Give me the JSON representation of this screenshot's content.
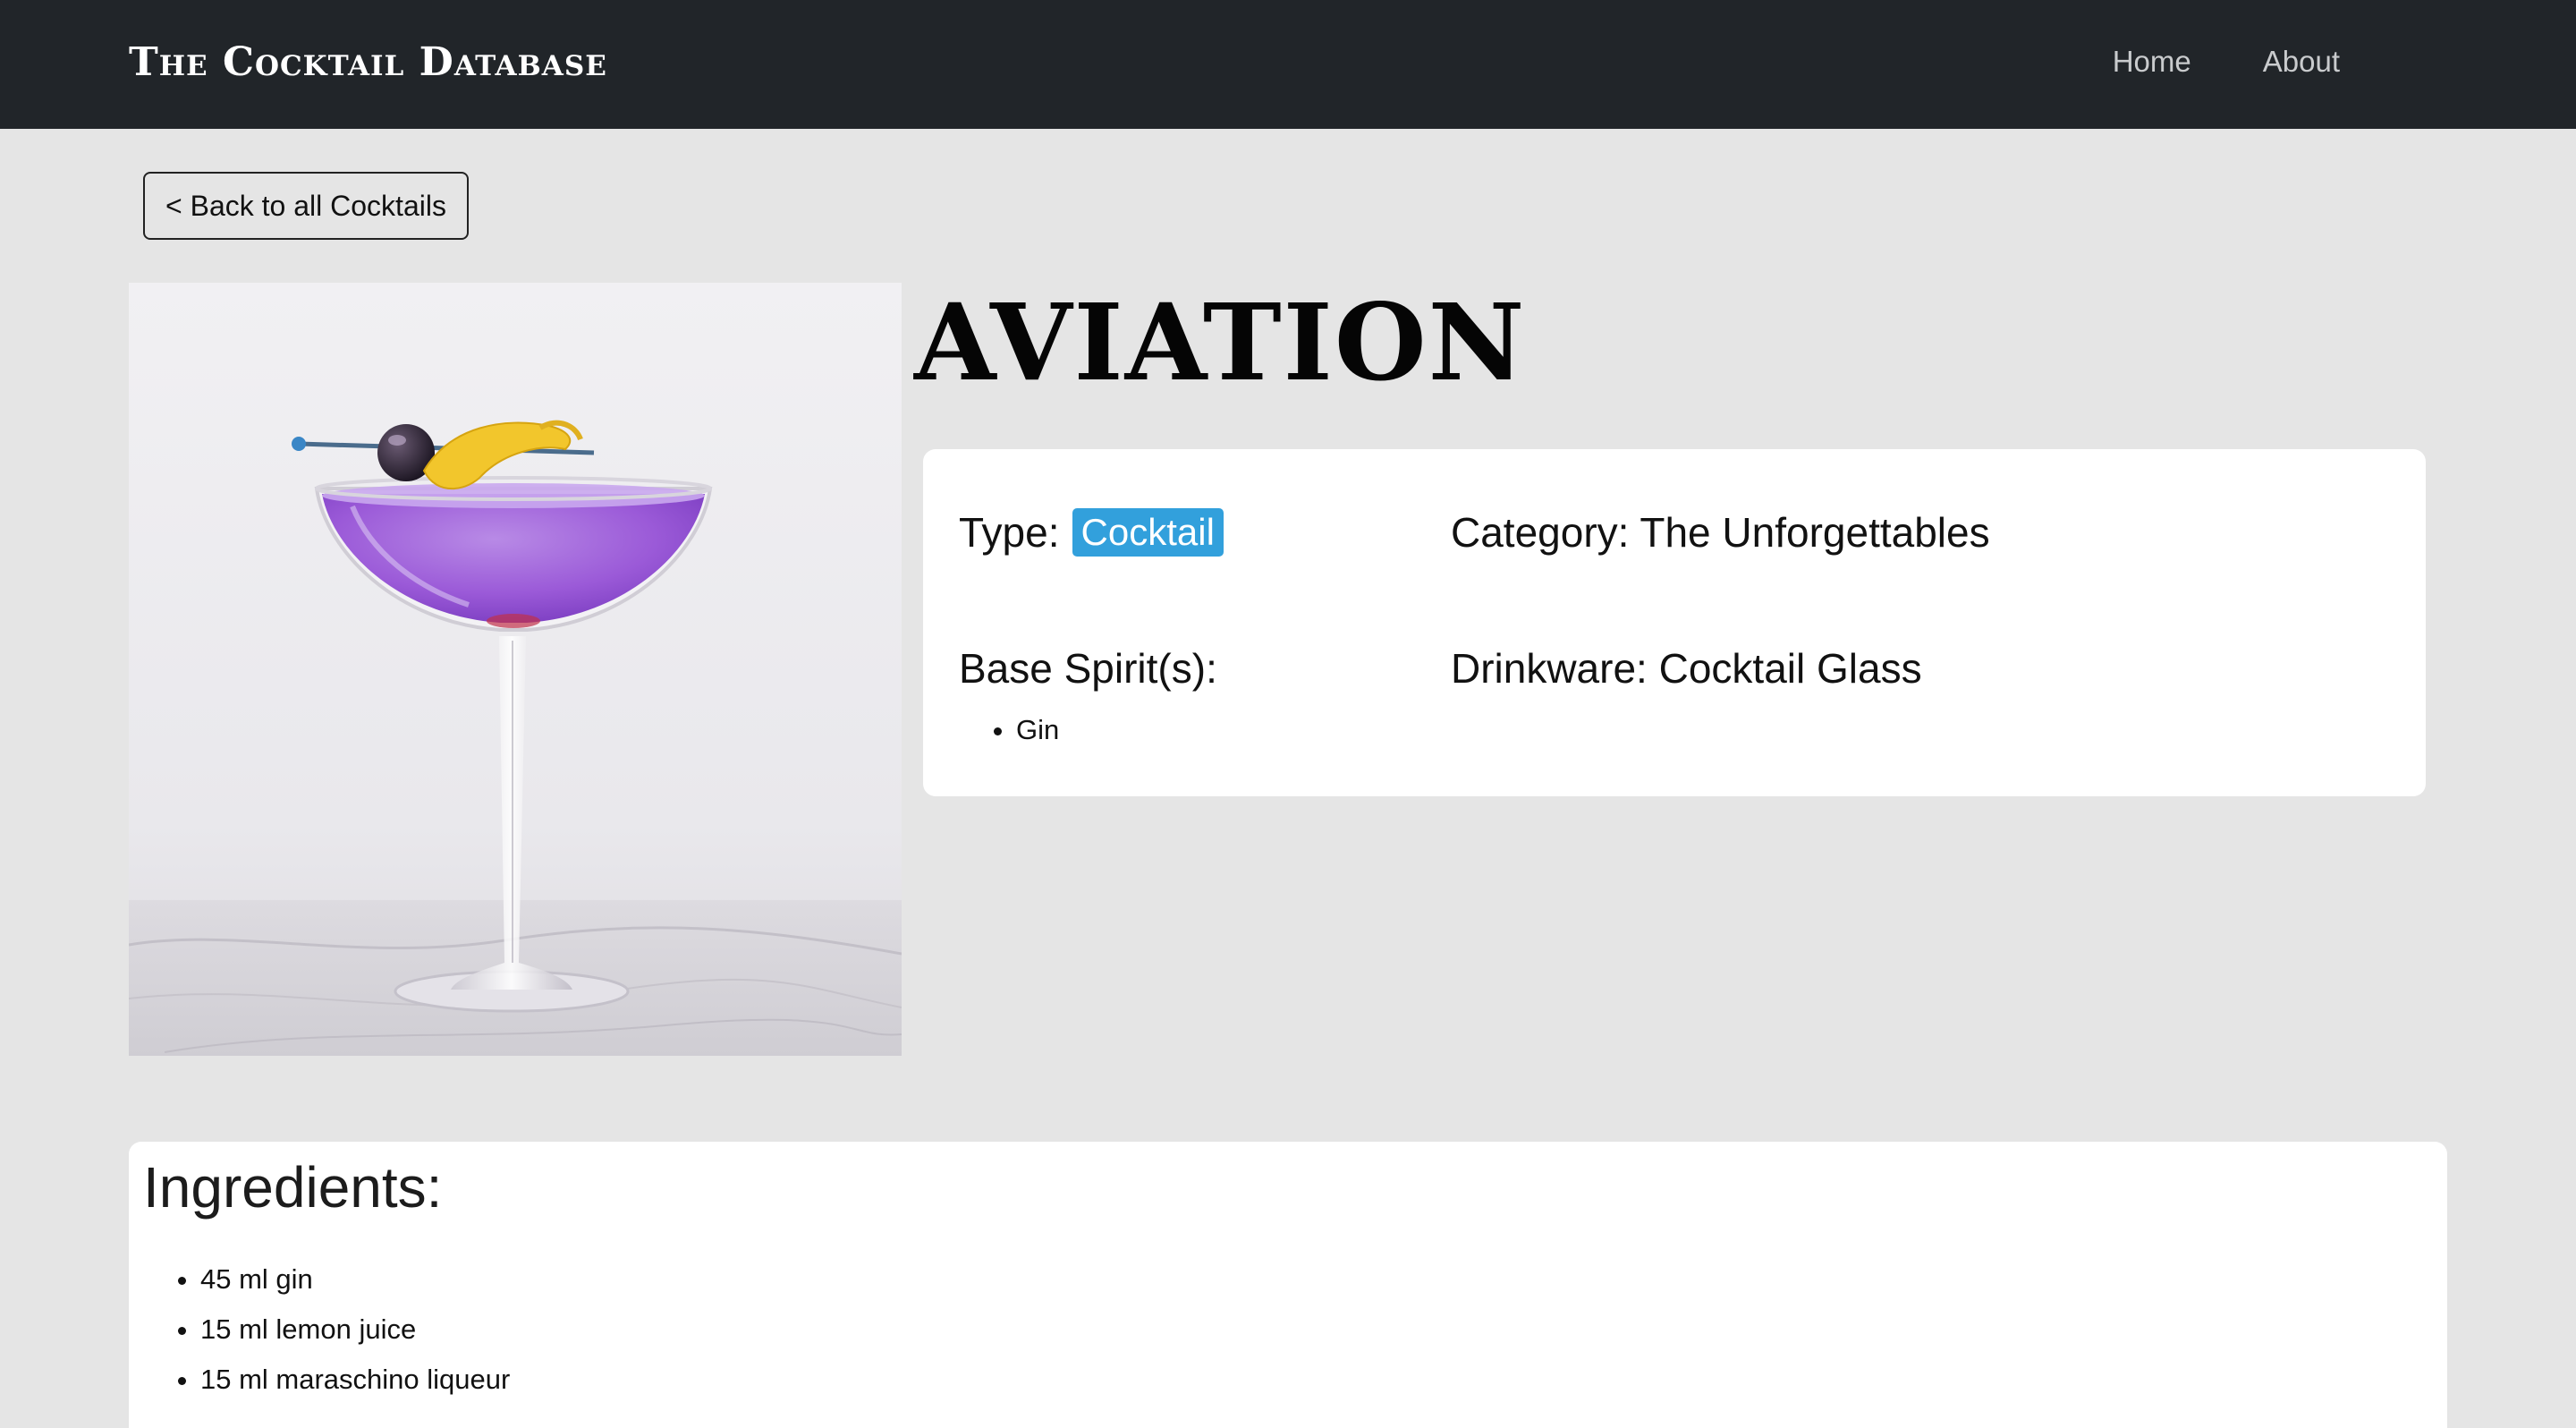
{
  "navbar": {
    "brand": "The Cocktail Database",
    "links": [
      {
        "label": "Home"
      },
      {
        "label": "About"
      }
    ]
  },
  "back_button": {
    "label": "< Back to all Cocktails"
  },
  "cocktail": {
    "name": "AVIATION",
    "type_label": "Type:",
    "type": "Cocktail",
    "category_label": "Category: The Unforgettables",
    "base_spirits_label": "Base Spirit(s):",
    "base_spirits": [
      "Gin"
    ],
    "drinkware_label": "Drinkware: Cocktail Glass"
  },
  "ingredients": {
    "title": "Ingredients:",
    "items": [
      "45 ml gin",
      "15 ml lemon juice",
      "15 ml maraschino liqueur"
    ]
  },
  "colors": {
    "navbar_bg": "#212529",
    "page_bg": "#e5e5e5",
    "badge_bg": "#32a0dc",
    "drink_purple": "#9b5ad8"
  }
}
